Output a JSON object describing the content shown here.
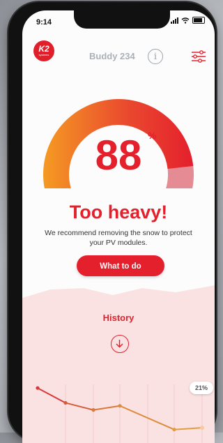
{
  "status_bar": {
    "time": "9:14"
  },
  "header": {
    "logo_text": "K2",
    "logo_sub": "systems",
    "device_name": "Buddy 234",
    "info_label": "i"
  },
  "gauge": {
    "value": "88",
    "unit": "%",
    "fill_fraction": 0.88
  },
  "status": {
    "title": "Too heavy!",
    "description": "We recommend removing the snow to protect your PV modules."
  },
  "action": {
    "label": "What to do"
  },
  "history": {
    "title": "History",
    "current_label": "21%"
  },
  "chart_data": {
    "type": "line",
    "series": [
      {
        "values": [
          88,
          63,
          51,
          58,
          18,
          21
        ]
      }
    ]
  },
  "colors": {
    "accent": "#e4202d",
    "gauge_start": "#f59a23",
    "gauge_end": "#e4202d",
    "gauge_rest": "#e58b94",
    "history_bg": "#fbe2e2"
  }
}
